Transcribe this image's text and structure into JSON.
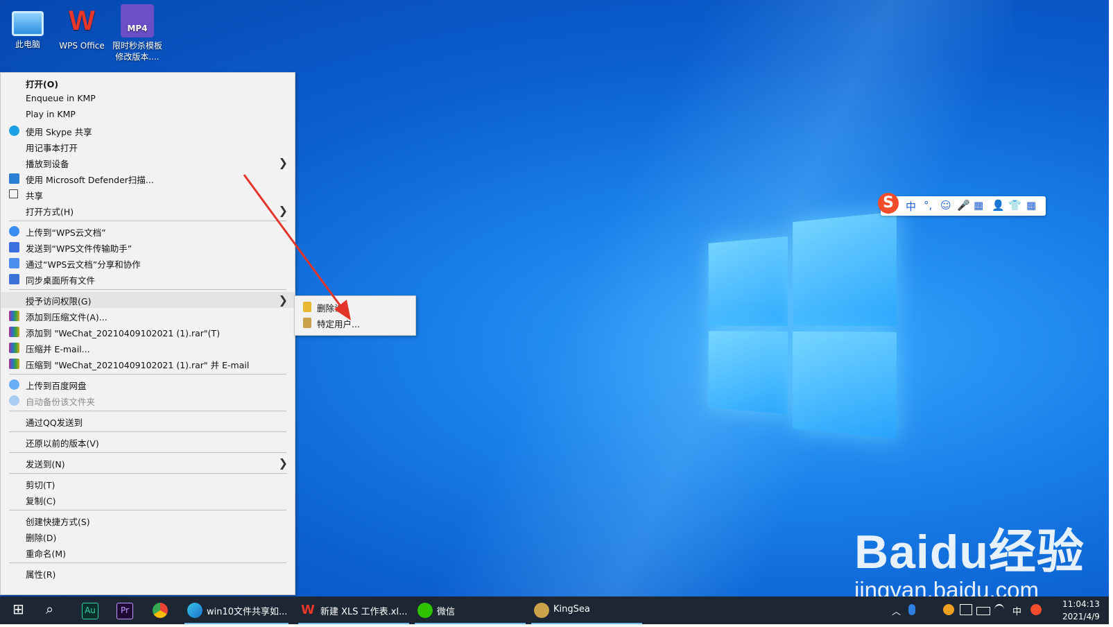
{
  "desktop": {
    "icons": [
      {
        "label": "此电脑"
      },
      {
        "label": "WPS Office"
      },
      {
        "label": "限时秒杀模板修改版本...."
      }
    ],
    "mp4_badge": "MP4"
  },
  "context_menu": {
    "items": [
      {
        "label": "打开(O)"
      },
      {
        "label": "Enqueue in KMP"
      },
      {
        "label": "Play in KMP"
      },
      {
        "label": "使用 Skype 共享"
      },
      {
        "label": "用记事本打开"
      },
      {
        "label": "播放到设备"
      },
      {
        "label": "使用 Microsoft Defender扫描..."
      },
      {
        "label": "共享"
      },
      {
        "label": "打开方式(H)"
      },
      {
        "label": "上传到“WPS云文档”"
      },
      {
        "label": "发送到“WPS文件传输助手”"
      },
      {
        "label": "通过“WPS云文档”分享和协作"
      },
      {
        "label": "同步桌面所有文件"
      },
      {
        "label": "授予访问权限(G)"
      },
      {
        "label": "添加到压缩文件(A)..."
      },
      {
        "label": "添加到 \"WeChat_20210409102021 (1).rar\"(T)"
      },
      {
        "label": "压缩并 E-mail..."
      },
      {
        "label": "压缩到 \"WeChat_20210409102021 (1).rar\" 并 E-mail"
      },
      {
        "label": "上传到百度网盘"
      },
      {
        "label": "自动备份该文件夹"
      },
      {
        "label": "通过QQ发送到"
      },
      {
        "label": "还原以前的版本(V)"
      },
      {
        "label": "发送到(N)"
      },
      {
        "label": "剪切(T)"
      },
      {
        "label": "复制(C)"
      },
      {
        "label": "创建快捷方式(S)"
      },
      {
        "label": "删除(D)"
      },
      {
        "label": "重命名(M)"
      },
      {
        "label": "属性(R)"
      }
    ],
    "arrow": "❯"
  },
  "submenu": {
    "items": [
      {
        "label": "删除访"
      },
      {
        "label": "特定用户..."
      }
    ]
  },
  "ime_bar": {
    "logo": "S",
    "items": [
      "中",
      "°,",
      "☺",
      "🎤",
      "▦",
      "👤",
      "👕",
      "▦"
    ]
  },
  "watermark": {
    "brand": "Bai",
    "brand_du": "du",
    "brand_cn": "经验",
    "url": "jingyan.baidu.com"
  },
  "taskbar": {
    "start_icon": "⊞",
    "search_icon": "⌕",
    "apps": [
      {
        "icon_text": "Au"
      },
      {
        "icon_text": "Pr"
      }
    ],
    "windows": [
      {
        "label": "win10文件共享如..."
      },
      {
        "label": "新建 XLS 工作表.xl..."
      },
      {
        "label": "微信"
      },
      {
        "label": "KingSea"
      }
    ],
    "tray": {
      "chevron": "︿",
      "ime": "中",
      "time": "11:04:13",
      "date": "2021/4/9"
    }
  },
  "colors": {
    "desktop_bg": "#0b5fd0",
    "menu_bg": "#f2f2f2",
    "taskbar_bg": "#1c2733",
    "arrow": "#e3342a"
  }
}
